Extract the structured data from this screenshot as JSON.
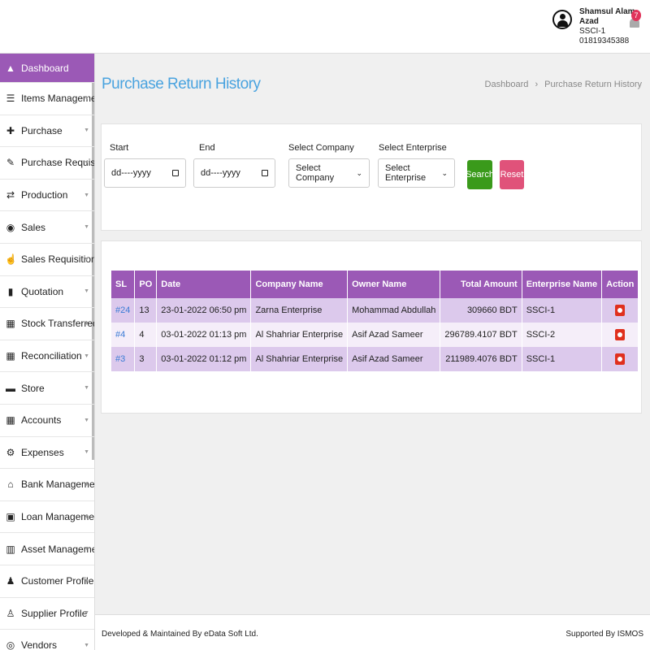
{
  "header": {
    "user_name": "Shamsul Alam Azad",
    "user_org": "SSCI-1",
    "user_phone": "01819345388",
    "notification_count": "7"
  },
  "sidebar": {
    "items": [
      {
        "label": "Dashboard",
        "icon": "dashboard-icon",
        "glyph": "▲",
        "active": true
      },
      {
        "label": "Items Management",
        "icon": "list-icon",
        "glyph": "☰"
      },
      {
        "label": "Purchase",
        "icon": "plus-square-icon",
        "glyph": "✚"
      },
      {
        "label": "Purchase Requisition",
        "icon": "edit-icon",
        "glyph": "✎"
      },
      {
        "label": "Production",
        "icon": "exchange-icon",
        "glyph": "⇄"
      },
      {
        "label": "Sales",
        "icon": "sales-icon",
        "glyph": "◉"
      },
      {
        "label": "Sales Requisition",
        "icon": "hand-pointer-icon",
        "glyph": "☝"
      },
      {
        "label": "Quotation",
        "icon": "file-icon",
        "glyph": "▮"
      },
      {
        "label": "Stock Transferred",
        "icon": "table-icon",
        "glyph": "▦"
      },
      {
        "label": "Reconciliation",
        "icon": "table-icon",
        "glyph": "▦"
      },
      {
        "label": "Store",
        "icon": "store-icon",
        "glyph": "▬"
      },
      {
        "label": "Accounts",
        "icon": "calculator-icon",
        "glyph": "▦"
      },
      {
        "label": "Expenses",
        "icon": "cogs-icon",
        "glyph": "⚙"
      },
      {
        "label": "Bank Management",
        "icon": "bank-icon",
        "glyph": "⌂"
      },
      {
        "label": "Loan Management",
        "icon": "money-icon",
        "glyph": "▣"
      },
      {
        "label": "Asset Management",
        "icon": "building-icon",
        "glyph": "▥"
      },
      {
        "label": "Customer Profile",
        "icon": "user-icon",
        "glyph": "♟"
      },
      {
        "label": "Supplier Profile",
        "icon": "user-outline-icon",
        "glyph": "♙"
      },
      {
        "label": "Vendors",
        "icon": "vendor-icon",
        "glyph": "◎"
      }
    ]
  },
  "page": {
    "title": "Purchase Return History",
    "breadcrumb_home": "Dashboard",
    "breadcrumb_sep": "›",
    "breadcrumb_current": "Purchase Return History"
  },
  "filters": {
    "start_label": "Start",
    "start_value": "dd----yyyy",
    "end_label": "End",
    "end_value": "dd----yyyy",
    "company_label": "Select Company",
    "company_value": "Select Company",
    "enterprise_label": "Select Enterprise",
    "enterprise_value": "Select Enterprise",
    "search_label": "Search",
    "reset_label": "Reset"
  },
  "table": {
    "headers": [
      "SL",
      "PO",
      "Date",
      "Company Name",
      "Owner Name",
      "Total Amount",
      "Enterprise Name",
      "Action"
    ],
    "rows": [
      {
        "sl": "#24",
        "po": "13",
        "date": "23-01-2022 06:50 pm",
        "company": "Zarna Enterprise",
        "owner": "Mohammad Abdullah",
        "amount": "309660 BDT",
        "enterprise": "SSCI-1"
      },
      {
        "sl": "#4",
        "po": "4",
        "date": "03-01-2022 01:13 pm",
        "company": "Al Shahriar Enterprise",
        "owner": "Asif Azad Sameer",
        "amount": "296789.4107 BDT",
        "enterprise": "SSCI-2"
      },
      {
        "sl": "#3",
        "po": "3",
        "date": "03-01-2022 01:12 pm",
        "company": "Al Shahriar Enterprise",
        "owner": "Asif Azad Sameer",
        "amount": "211989.4076 BDT",
        "enterprise": "SSCI-1"
      }
    ]
  },
  "footer": {
    "left": "Developed & Maintained By eData Soft Ltd.",
    "right": "Supported By ISMOS"
  },
  "colors": {
    "accent": "#9b59b6",
    "title": "#4aa3df",
    "search": "#3a9a1b",
    "reset": "#e0527a",
    "action": "#e0301e"
  }
}
